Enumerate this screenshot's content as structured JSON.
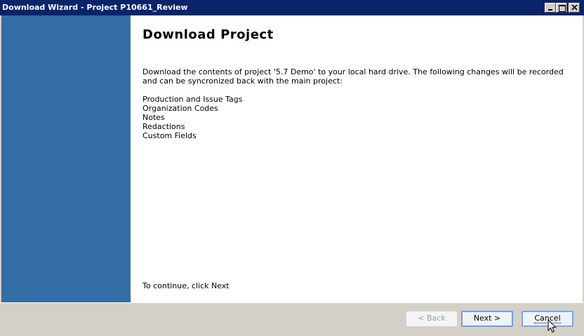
{
  "window": {
    "title": "Download Wizard - Project P10661_Review"
  },
  "page": {
    "heading": "Download Project",
    "description": "Download the contents of project '5.7 Demo' to your local hard drive.  The following changes will be recorded and can be syncronized back with the main project:",
    "changes": [
      "Production and Issue Tags",
      "Organization Codes",
      "Notes",
      "Redactions",
      "Custom Fields"
    ],
    "continue_text": "To continue, click Next"
  },
  "buttons": {
    "back": "< Back",
    "next": "Next >",
    "cancel": "Cancel"
  },
  "colors": {
    "titlebar": "#0a246a",
    "sidebar": "#336ca6",
    "content_bg": "#ffffff",
    "dialog_bg": "#d4d0c8"
  },
  "icons": {
    "minimize": "minimize-icon",
    "maximize": "maximize-icon",
    "close": "close-icon",
    "cursor": "mouse-pointer-icon"
  }
}
